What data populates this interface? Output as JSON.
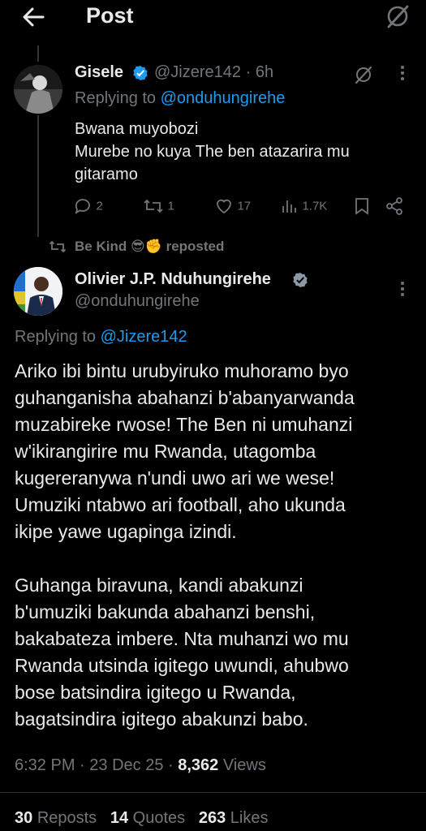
{
  "header": {
    "title": "Post"
  },
  "reply_tweet": {
    "name": "Gisele",
    "handle": "@Jizere142",
    "sep": "·",
    "time": "6h",
    "replying_prefix": "Replying to",
    "replying_to": "@onduhungirehe",
    "text_lines": [
      "Bwana muyobozi",
      "Murebe no kuya The ben atazarira mu",
      "gitaramo"
    ],
    "stats": {
      "replies": "2",
      "reposts": "1",
      "likes": "17",
      "views": "1.7K"
    }
  },
  "repost_label": {
    "text": "Be Kind",
    "emoji": "😎✊",
    "suffix": "reposted"
  },
  "main_tweet": {
    "name": "Olivier J.P. Nduhungirehe",
    "handle": "@onduhungirehe",
    "replying_prefix": "Replying to",
    "replying_to": "@Jizere142",
    "paragraph1_lines": [
      "Ariko ibi bintu urubyiruko muhoramo byo",
      "guhanganisha abahanzi b'abanyarwanda",
      "muzabireke rwose! The Ben ni umuhanzi",
      "w'ikirangirire mu Rwanda, utagomba",
      "kugereranywa n'undi uwo ari we wese!",
      "Umuziki ntabwo ari football, aho ukunda",
      "ikipe yawe ugapinga izindi."
    ],
    "paragraph2_lines": [
      "Guhanga biravuna, kandi abakunzi",
      "b'umuziki bakunda abahanzi benshi,",
      "bakabateza imbere. Nta muhanzi wo mu",
      "Rwanda utsinda igitego uwundi, ahubwo",
      "bose batsindira igitego u Rwanda,",
      "bagatsindira igitego abakunzi babo."
    ],
    "time": "6:32 PM",
    "date": "23 Dec 25",
    "views_count": "8,362",
    "views_label": "Views",
    "reposts_count": "30",
    "reposts_label": "Reposts",
    "quotes_count": "14",
    "quotes_label": "Quotes",
    "likes_count": "263",
    "likes_label": "Likes"
  },
  "colors": {
    "background": "#000000",
    "text": "#e7e9ea",
    "muted": "#71767b",
    "link": "#1d9bf0",
    "verified": "#1d9bf0"
  }
}
